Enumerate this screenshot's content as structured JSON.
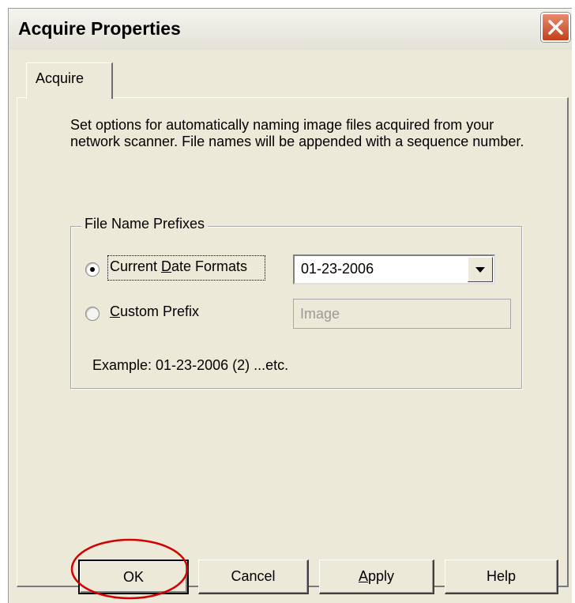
{
  "window": {
    "title": "Acquire Properties"
  },
  "tabs": [
    {
      "label": "Acquire"
    }
  ],
  "description": "Set options for automatically naming image files acquired from your network scanner. File names will be appended with a sequence number.",
  "group": {
    "legend": "File Name Prefixes",
    "option_date": {
      "label_mnemonic": "D",
      "label_before": "Current ",
      "label_after": "ate Formats",
      "selected": true
    },
    "option_custom": {
      "label_mnemonic": "C",
      "label_after": "ustom Prefix",
      "selected": false
    },
    "date_format_value": "01-23-2006",
    "custom_prefix_value": "Image",
    "example": "Example: 01-23-2006 (2) ...etc."
  },
  "buttons": {
    "ok": "OK",
    "cancel": "Cancel",
    "apply_mnemonic": "A",
    "apply_rest": "pply",
    "help": "Help"
  },
  "colors": {
    "face": "#ece9d8",
    "close": "#c3411c",
    "annotation": "#d40000"
  },
  "icons": {
    "close": "close-icon",
    "dropdown": "chevron-down-icon"
  }
}
